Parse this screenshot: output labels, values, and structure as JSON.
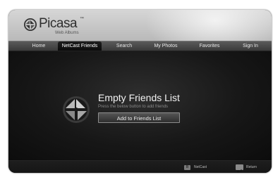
{
  "logo": {
    "word": "Picasa",
    "tm": "™",
    "sub": "Web Albums"
  },
  "nav": {
    "tabs": [
      {
        "label": "Home"
      },
      {
        "label": "NetCast Friends"
      },
      {
        "label": "Search"
      },
      {
        "label": "My Photos"
      },
      {
        "label": "Favorites"
      },
      {
        "label": "Sign In"
      }
    ],
    "active": "NetCast Friends"
  },
  "main": {
    "title": "Empty Friends List",
    "subtitle": "Press the below button to add friends",
    "button_label": "Add to Friends List"
  },
  "footer": {
    "netcast_key": "B",
    "netcast_label": "NetCast",
    "return_label": "Return"
  },
  "colors": {
    "header": "#c8c8c8",
    "nav_bar": "#4a4a4a",
    "background": "#151515",
    "text": "#f2f2f2"
  },
  "icons": [
    "picasa-logo-icon",
    "return-icon"
  ]
}
